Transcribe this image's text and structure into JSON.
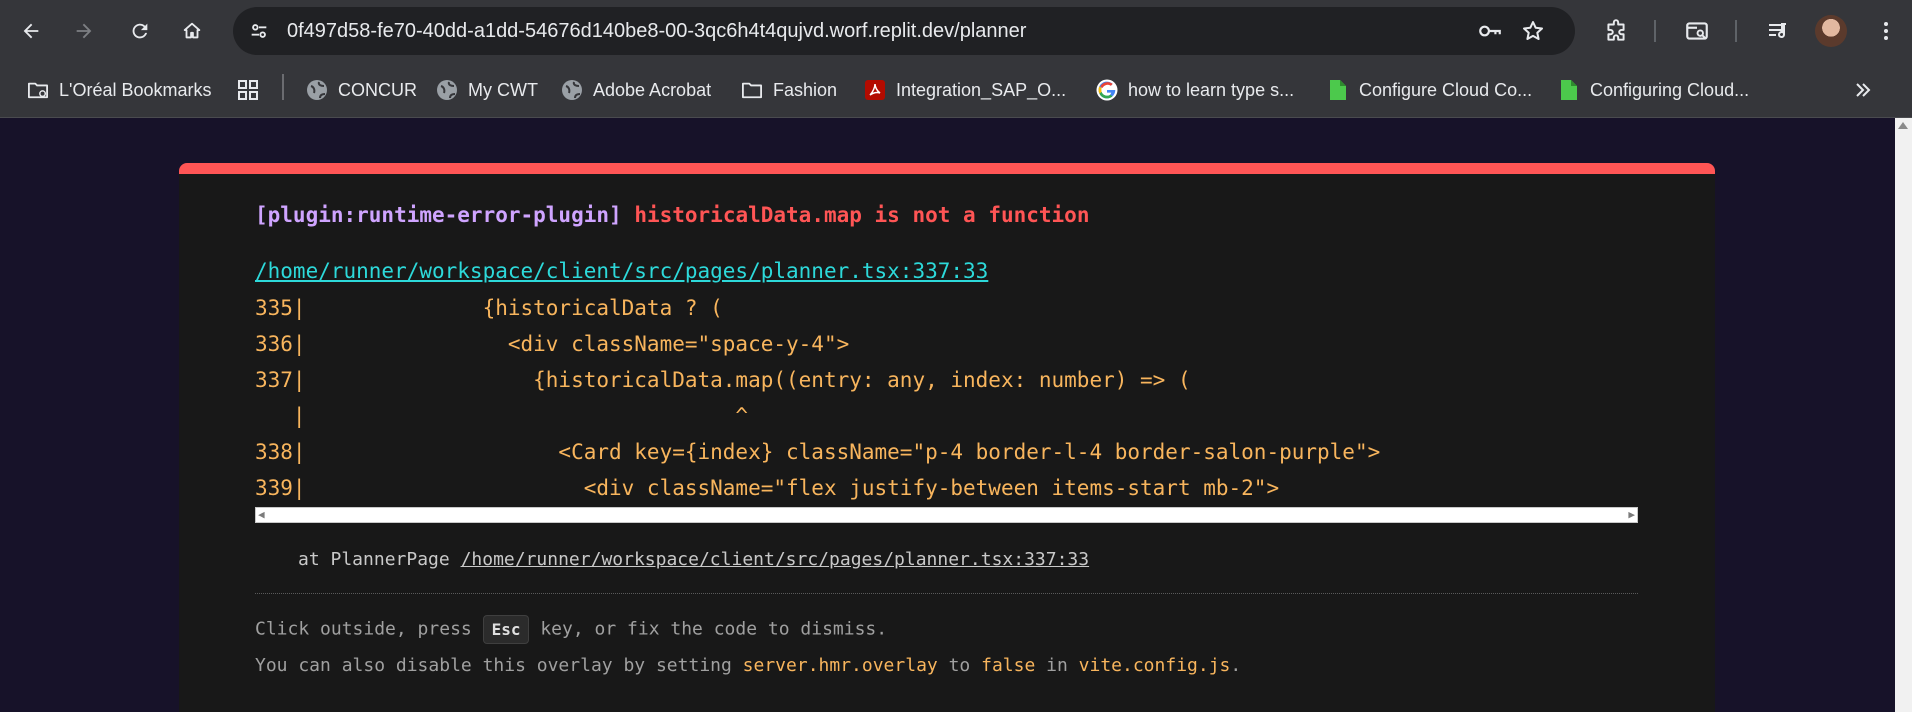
{
  "browser": {
    "url_host": "0f497d58-fe70-40dd-a1dd-54676d140be8-00-3qc6h4t4qujvd.worf.replit.dev",
    "url_path": "/planner",
    "icons": [
      "back-icon",
      "forward-icon",
      "reload-icon",
      "home-icon",
      "tune-icon",
      "key-icon",
      "star-icon",
      "extensions-icon",
      "search-tabs-icon",
      "media-icon",
      "profile-avatar",
      "menu-icon"
    ],
    "bookmarks": [
      {
        "label": "L'Oréal Bookmarks",
        "icon": "folder-icon"
      },
      {
        "label": "",
        "icon": "apps-grid-icon"
      },
      {
        "label": "CONCUR",
        "icon": "globe-icon"
      },
      {
        "label": "My CWT",
        "icon": "globe-icon"
      },
      {
        "label": "Adobe Acrobat",
        "icon": "globe-icon"
      },
      {
        "label": "Fashion",
        "icon": "folder-icon"
      },
      {
        "label": "Integration_SAP_O...",
        "icon": "pdf-icon"
      },
      {
        "label": "how to learn type s...",
        "icon": "google-icon"
      },
      {
        "label": "Configure Cloud Co...",
        "icon": "page-icon"
      },
      {
        "label": "Configuring Cloud...",
        "icon": "page-icon"
      }
    ]
  },
  "overlay": {
    "accent_color": "#ff5555",
    "plugin": "[plugin:runtime-error-plugin]",
    "message": "historicalData.map is not a function",
    "file": "/home/runner/workspace/client/src/pages/planner.tsx:337:33",
    "code_lines": [
      "335|              {historicalData ? (",
      "336|                <div className=\"space-y-4\">",
      "337|                  {historicalData.map((entry: any, index: number) => (",
      "   |                                  ^",
      "338|                    <Card key={index} className=\"p-4 border-l-4 border-salon-purple\">",
      "339|                      <div className=\"flex justify-between items-start mb-2\">"
    ],
    "stack_prefix": "at PlannerPage ",
    "stack_path": "/home/runner/workspace/client/src/pages/planner.tsx:337:33",
    "tip1_a": "Click outside, press ",
    "tip1_key": "Esc",
    "tip1_b": " key, or fix the code to dismiss.",
    "tip2_a": "You can also disable this overlay by setting ",
    "tip2_code1": "server.hmr.overlay",
    "tip2_b": " to ",
    "tip2_code2": "false",
    "tip2_c": " in ",
    "tip2_code3": "vite.config.js",
    "tip2_d": "."
  }
}
